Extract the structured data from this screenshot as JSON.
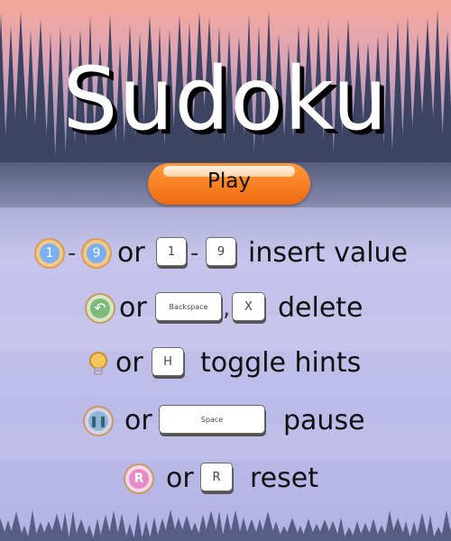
{
  "title": "Sudoku",
  "play_label": "Play",
  "controls": [
    {
      "pre": "1",
      "dash1": "-",
      "pre2": "9",
      "or": "or",
      "k1": "1",
      "dash2": "-",
      "k2": "9",
      "action": "insert value"
    },
    {
      "or": "or",
      "k1": "Backspace",
      "comma": ",",
      "k2": "X",
      "action": "delete"
    },
    {
      "or": "or",
      "k1": "H",
      "action": "toggle hints"
    },
    {
      "or": "or",
      "k1": "Space",
      "action": "pause"
    },
    {
      "coin": "R",
      "or": "or",
      "k1": "R",
      "action": "reset"
    }
  ],
  "colors": {
    "play_button": "#f47a1c",
    "coin_blue": "#5b8fd6",
    "coin_green": "#6fb06a",
    "coin_pink": "#e07ab9",
    "coin_tan": "#e6b450"
  }
}
